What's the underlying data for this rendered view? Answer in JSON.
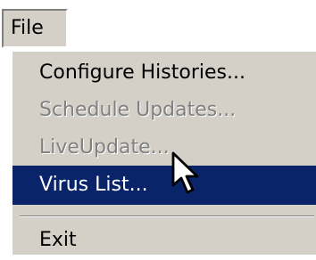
{
  "menubar": {
    "file_label": "File"
  },
  "menu": {
    "items": [
      {
        "label": "Configure Histories...",
        "state": "enabled"
      },
      {
        "label": "Schedule Updates...",
        "state": "disabled"
      },
      {
        "label": "LiveUpdate...",
        "state": "disabled"
      },
      {
        "label": "Virus List...",
        "state": "selected"
      },
      {
        "label": "Exit",
        "state": "enabled"
      }
    ]
  },
  "cursor": {
    "icon": "arrow-pointer-icon"
  },
  "colors": {
    "menu_background": "#d4d0c8",
    "highlight_background": "#0a246a",
    "highlight_text": "#ffffff",
    "disabled_text": "#808080"
  }
}
